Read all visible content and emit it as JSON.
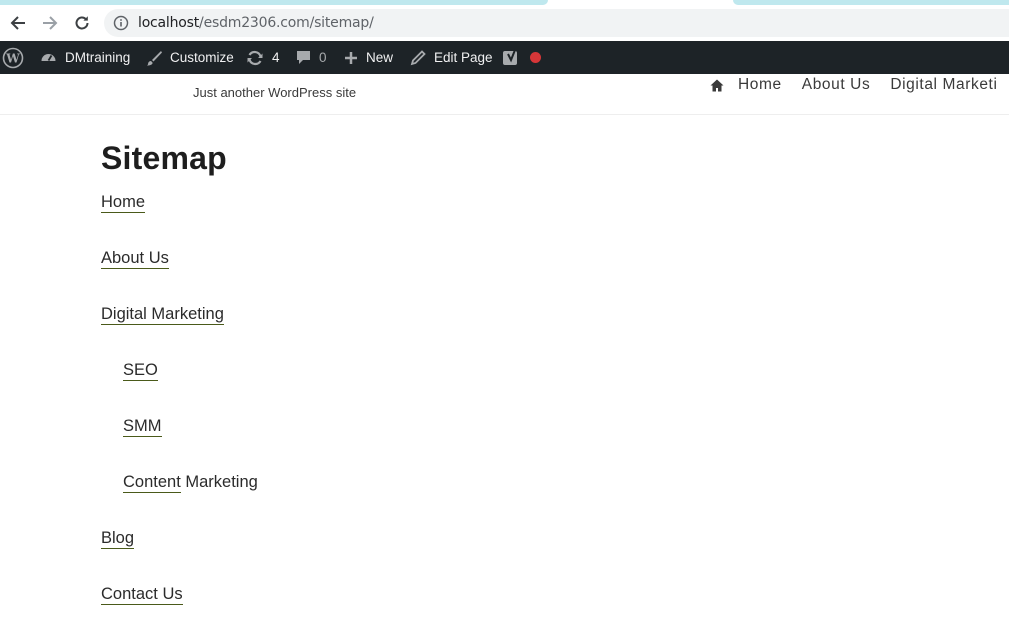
{
  "browser": {
    "url_host": "localhost",
    "url_path": "/esdm2306.com/sitemap/"
  },
  "adminbar": {
    "site_name": "DMtraining",
    "customize": "Customize",
    "updates_count": "4",
    "comments_count": "0",
    "new_label": "New",
    "edit_page": "Edit Page",
    "seo_status_color": "#d63638"
  },
  "site": {
    "tagline": "Just another WordPress site",
    "nav": [
      "Home",
      "About Us",
      "Digital Marketi"
    ]
  },
  "page": {
    "title": "Sitemap",
    "links": {
      "home": "Home",
      "about": "About Us",
      "digital_marketing": "Digital Marketing",
      "seo": "SEO",
      "smm": "SMM",
      "content": "Content",
      "content_rest": " Marketing",
      "blog": "Blog",
      "contact": "Contact Us"
    }
  },
  "colors": {
    "adminbar_bg": "#1d2327",
    "link_underline": "#4a5a1a"
  }
}
